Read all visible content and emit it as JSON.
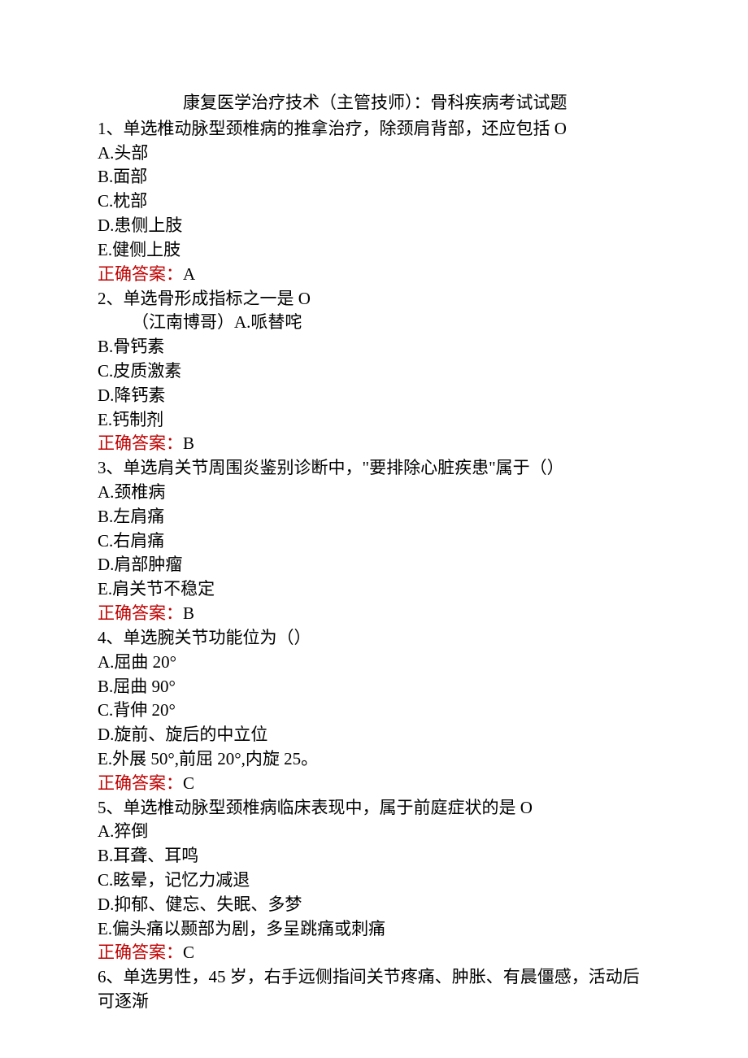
{
  "title": "康复医学治疗技术（主管技师）：骨科疾病考试试题",
  "questions": [
    {
      "stem": "1、单选椎动脉型颈椎病的推拿治疗，除颈肩背部，还应包括 O",
      "options": [
        "A.头部",
        "B.面部",
        "C.枕部",
        "D.患侧上肢",
        "E.健侧上肢"
      ],
      "answer_label": "正确答案：",
      "answer_value": "A"
    },
    {
      "stem": "2、单选骨形成指标之一是 O",
      "indent_first": "（江南博哥）A.哌替咤",
      "options": [
        "B.骨钙素",
        "C.皮质激素",
        "D.降钙素",
        "E.钙制剂"
      ],
      "answer_label": "正确答案：",
      "answer_value": "B"
    },
    {
      "stem": "3、单选肩关节周围炎鉴别诊断中，\"要排除心脏疾患\"属于（）",
      "options": [
        "A.颈椎病",
        "B.左肩痛",
        "C.右肩痛",
        "D.肩部肿瘤",
        "E.肩关节不稳定"
      ],
      "answer_label": "正确答案：",
      "answer_value": "B"
    },
    {
      "stem": "4、单选腕关节功能位为（）",
      "options": [
        "A.屈曲 20°",
        "B.屈曲 90°",
        "C.背伸 20°",
        "D.旋前、旋后的中立位",
        "E.外展 50°,前屈 20°,内旋 25。"
      ],
      "answer_label": "正确答案：",
      "answer_value": "C"
    },
    {
      "stem": "5、单选椎动脉型颈椎病临床表现中，属于前庭症状的是 O",
      "options": [
        "A.猝倒",
        "B.耳聋、耳鸣",
        "C.眩晕，记忆力减退",
        "D.抑郁、健忘、失眠、多梦",
        "E.偏头痛以颞部为剧，多呈跳痛或刺痛"
      ],
      "answer_label": "正确答案：",
      "answer_value": "C"
    },
    {
      "stem": "6、单选男性，45 岁，右手远侧指间关节疼痛、肿胀、有晨僵感，活动后可逐渐"
    }
  ]
}
